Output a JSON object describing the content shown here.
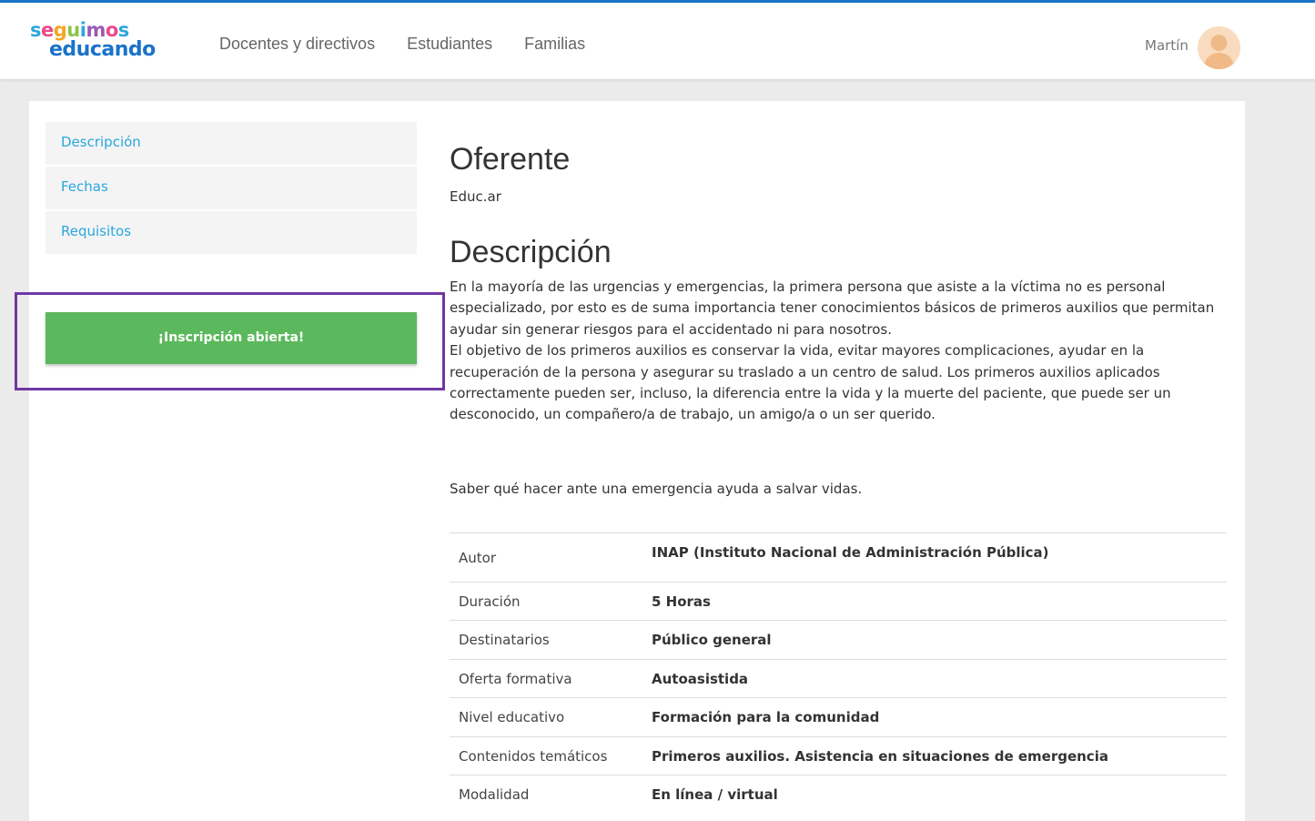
{
  "header": {
    "logo_line1": "seguimos",
    "logo_line2": "educando",
    "nav": [
      "Docentes y directivos",
      "Estudiantes",
      "Familias"
    ],
    "user_name": "Martín"
  },
  "sidebar": {
    "items": [
      {
        "label": "Descripción"
      },
      {
        "label": "Fechas"
      },
      {
        "label": "Requisitos"
      }
    ],
    "enroll_button": "¡Inscripción abierta!"
  },
  "content": {
    "oferente_title": "Oferente",
    "oferente_value": "Educ.ar",
    "description_title": "Descripción",
    "paragraphs": [
      "En la mayoría de las urgencias y emergencias, la primera persona que asiste a la víctima no es personal especializado, por esto es de suma importancia tener conocimientos básicos de primeros auxilios que permitan ayudar sin generar riesgos para el accidentado ni para nosotros.",
      "El objetivo de los primeros auxilios es conservar la vida, evitar mayores complicaciones, ayudar en la recuperación de la persona y asegurar su traslado a un centro de salud. Los primeros auxilios aplicados correctamente pueden ser, incluso, la diferencia entre la vida y la muerte del paciente, que puede ser un desconocido, un compañero/a de trabajo, un amigo/a o un ser querido.",
      "Saber qué hacer ante una emergencia ayuda a salvar vidas."
    ]
  },
  "details": [
    {
      "key": "Autor",
      "value": "INAP (Instituto Nacional de Administración Pública)"
    },
    {
      "key": "Duración",
      "value": "5 Horas"
    },
    {
      "key": "Destinatarios",
      "value": "Público general"
    },
    {
      "key": "Oferta formativa",
      "value": "Autoasistida"
    },
    {
      "key": "Nivel educativo",
      "value": "Formación para la comunidad"
    },
    {
      "key": "Contenidos temáticos",
      "value": "Primeros auxilios. Asistencia en situaciones de emergencia"
    },
    {
      "key": "Modalidad",
      "value": "En línea / virtual"
    }
  ],
  "colors": {
    "accent_blue": "#1a73c8",
    "link_blue": "#2aa7de",
    "button_green": "#5cb85c",
    "highlight_purple": "#6f37a3"
  }
}
